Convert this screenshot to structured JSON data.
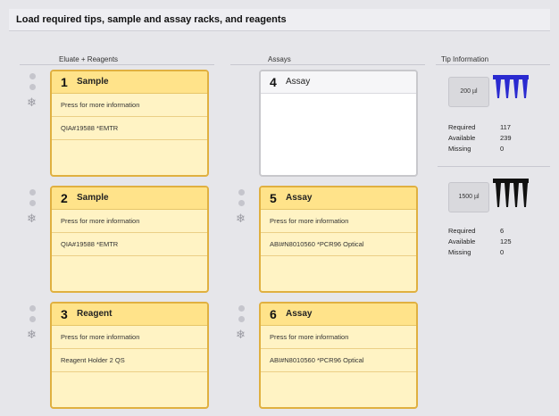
{
  "header": {
    "title": "Load required tips, sample and assay racks, and reagents"
  },
  "columns": {
    "left_label": "Eluate + Reagents",
    "middle_label": "Assays",
    "right_label": "Tip Information"
  },
  "cards": [
    {
      "num": "1",
      "name": "Sample",
      "info": "Press for more information",
      "detail": "QIA#19588 *EMTR"
    },
    {
      "num": "2",
      "name": "Sample",
      "info": "Press for more information",
      "detail": "QIA#19588 *EMTR"
    },
    {
      "num": "3",
      "name": "Reagent",
      "info": "Press for more information",
      "detail": "Reagent Holder 2 QS"
    },
    {
      "num": "4",
      "name": "Assay"
    },
    {
      "num": "5",
      "name": "Assay",
      "info": "Press for more information",
      "detail": "ABI#N8010560 *PCR96 Optical"
    },
    {
      "num": "6",
      "name": "Assay",
      "info": "Press for more information",
      "detail": "ABI#N8010560 *PCR96 Optical"
    }
  ],
  "tips": [
    {
      "size": "200 µl",
      "color": "#2a2ad0",
      "rows": [
        {
          "label": "Required",
          "value": "117"
        },
        {
          "label": "Available",
          "value": "239"
        },
        {
          "label": "Missing",
          "value": "0"
        }
      ]
    },
    {
      "size": "1500 µl",
      "color": "#111111",
      "rows": [
        {
          "label": "Required",
          "value": "6"
        },
        {
          "label": "Available",
          "value": "125"
        },
        {
          "label": "Missing",
          "value": "0"
        }
      ]
    }
  ]
}
